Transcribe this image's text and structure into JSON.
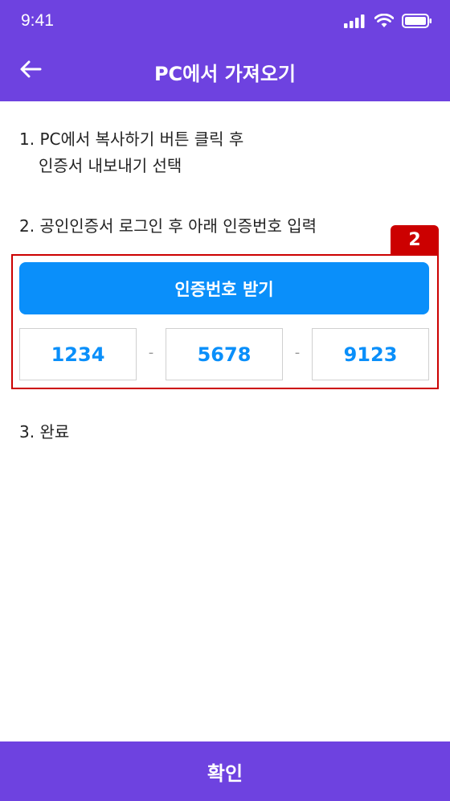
{
  "status_bar": {
    "time": "9:41",
    "icons": [
      "signal-icon",
      "wifi-icon",
      "battery-icon"
    ]
  },
  "app_bar": {
    "back_icon": "arrow-left-icon",
    "title": "PC에서 가져오기"
  },
  "steps": {
    "step1_line1": "1. PC에서 복사하기 버튼 클릭 후",
    "step1_line2": "인증서 내보내기 선택",
    "step2": "2. 공인인증서 로그인 후 아래 인증번호 입력",
    "step3": "3. 완료"
  },
  "annotation": {
    "badge": "2"
  },
  "auth": {
    "receive_button_label": "인증번호 받기",
    "codes": [
      "1234",
      "5678",
      "9123"
    ],
    "separator": "-"
  },
  "footer": {
    "confirm_label": "확인"
  },
  "colors": {
    "primary": "#6e42e0",
    "accent": "#0a8ffa",
    "annotation": "#cc0000"
  }
}
